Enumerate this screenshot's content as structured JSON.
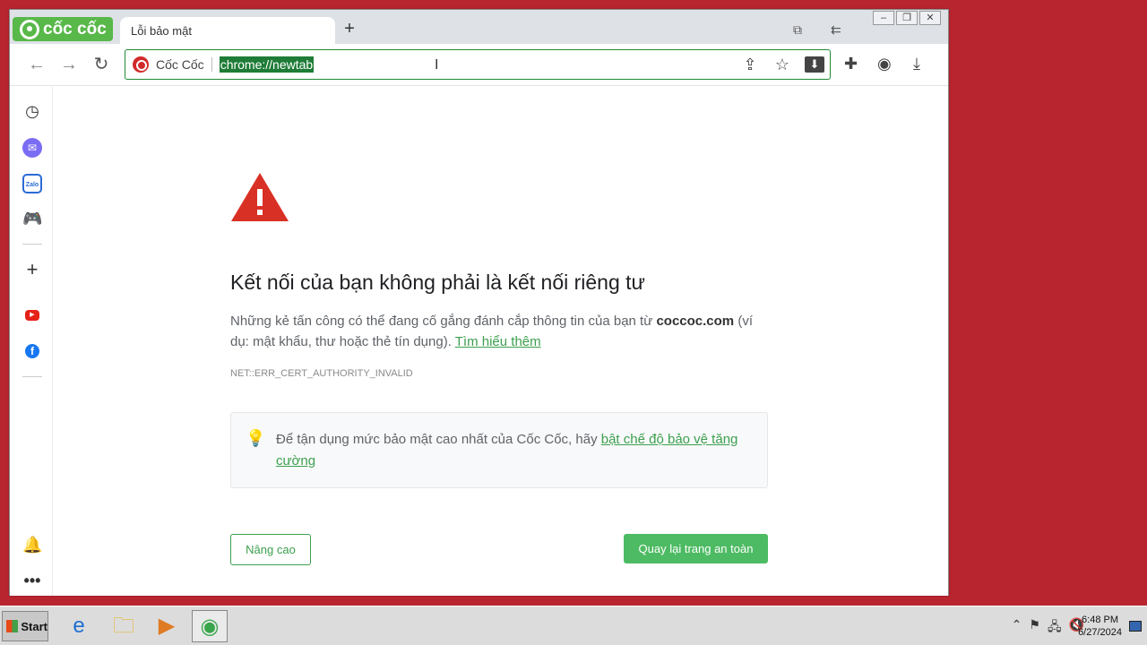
{
  "browser": {
    "brand": "cốc cốc",
    "tab_title": "Lỗi bảo mật",
    "new_tab": "+",
    "omnibox_brand": "Cốc Cốc",
    "url": "chrome://newtab"
  },
  "page": {
    "heading": "Kết nối của bạn không phải là kết nối riêng tư",
    "desc_prefix": "Những kẻ tấn công có thể đang cố gắng đánh cắp thông tin của bạn từ ",
    "desc_domain": "coccoc.com",
    "desc_suffix": " (ví dụ: mật khẩu, thư hoặc thẻ tín dụng). ",
    "learn_more": "Tìm hiểu thêm",
    "error_code": "NET::ERR_CERT_AUTHORITY_INVALID",
    "tip_text": "Để tận dụng mức bảo mật cao nhất của Cốc Cốc, hãy ",
    "tip_link": "bật chế độ bảo vệ tăng cường",
    "advanced_button": "Nâng cao",
    "back_button": "Quay lại trang an toàn"
  },
  "colors": {
    "accent_green": "#4dbb63",
    "link_green": "#3c9f4e",
    "warning_red": "#d93025",
    "desktop": "#b8252f"
  },
  "taskbar": {
    "start_label": "Start",
    "time": "6:48 PM",
    "date": "6/27/2024"
  }
}
